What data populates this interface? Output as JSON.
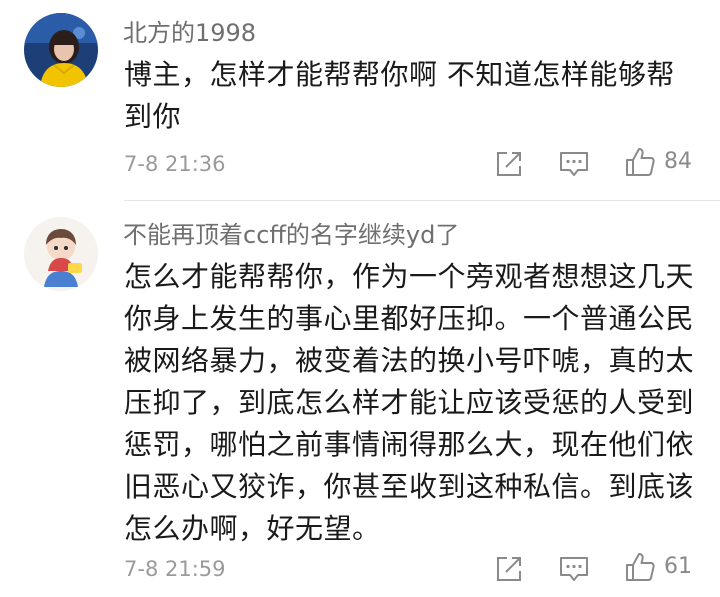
{
  "comments": [
    {
      "username": "北方的1998",
      "content": "博主，怎样才能帮帮你啊 不知道怎样能够帮到你",
      "time": "7-8 21:36",
      "likes": "84",
      "icons": [
        "share-icon",
        "reply-icon",
        "thumbs-up-icon"
      ]
    },
    {
      "username": "不能再顶着ccff的名字继续yd了",
      "content": "怎么才能帮帮你，作为一个旁观者想想这几天你身上发生的事心里都好压抑。一个普通公民被网络暴力，被变着法的换小号吓唬，真的太压抑了，到底怎么样才能让应该受惩的人受到惩罚，哪怕之前事情闹得那么大，现在他们依旧恶心又狡诈，你甚至收到这种私信。到底该怎么办啊，好无望。",
      "time": "7-8 21:59",
      "likes": "61",
      "icons": [
        "share-icon",
        "reply-icon",
        "thumbs-up-icon"
      ]
    }
  ]
}
